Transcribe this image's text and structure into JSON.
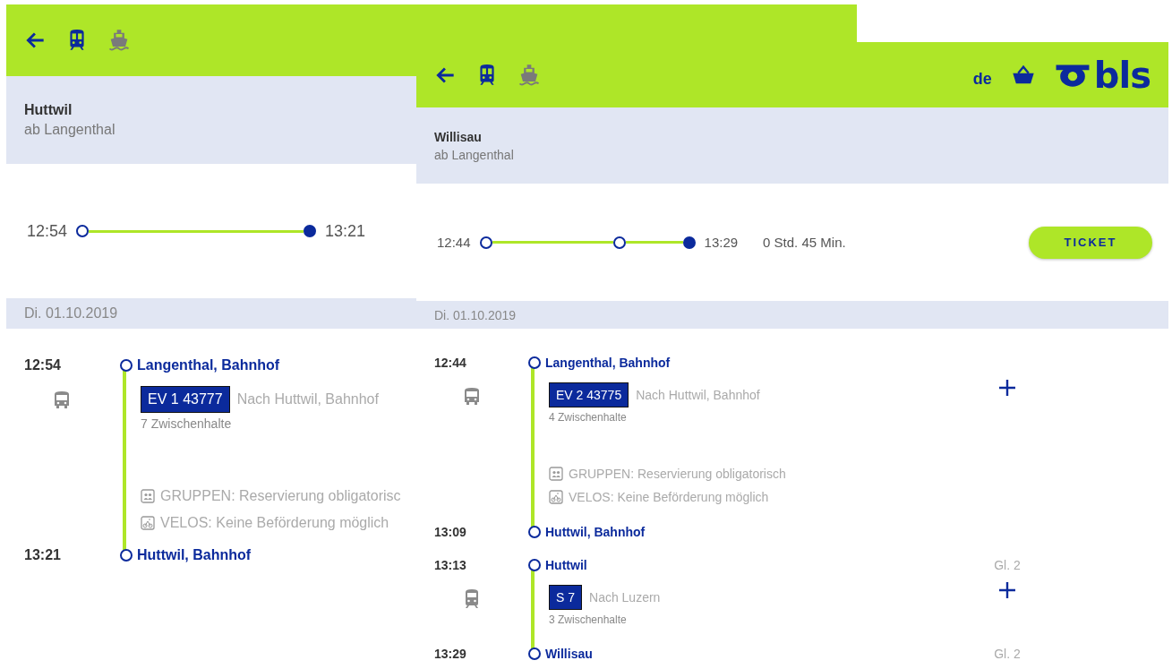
{
  "panels": [
    {
      "title": "Huttwil",
      "subtitle": "ab Langenthal",
      "timeline": {
        "start": "12:54",
        "end": "13:21",
        "dots": [
          {
            "filled": false
          },
          {
            "filled": true
          }
        ]
      },
      "date": "Di. 01.10.2019",
      "rows": [
        {
          "kind": "stop",
          "time": "12:54",
          "name": "Langenthal, Bahnhof"
        },
        {
          "kind": "bus",
          "badge": "EV 1 43777",
          "direction": "Nach Huttwil, Bahnhof",
          "stops": "7 Zwischenhalte",
          "notes": [
            {
              "kind": "groups",
              "text": "GRUPPEN: Reservierung obligatorisc"
            },
            {
              "kind": "bike",
              "text": "VELOS: Keine Beförderung möglich"
            }
          ]
        },
        {
          "kind": "stop",
          "time": "13:21",
          "name": "Huttwil, Bahnhof"
        }
      ]
    },
    {
      "header": {
        "language": "de",
        "logo_text": "bls"
      },
      "title": "Willisau",
      "subtitle": "ab Langenthal",
      "timeline": {
        "start": "12:44",
        "end": "13:29",
        "dots": [
          {
            "filled": false
          },
          {
            "filled": false
          },
          {
            "filled": true
          }
        ]
      },
      "duration": "0 Std. 45 Min.",
      "ticket": "TICKET",
      "date": "Di. 01.10.2019",
      "rows": [
        {
          "kind": "stop",
          "time": "12:44",
          "name": "Langenthal, Bahnhof"
        },
        {
          "kind": "bus",
          "badge": "EV 2 43775",
          "direction": "Nach Huttwil, Bahnhof",
          "stops": "4 Zwischenhalte",
          "plus": true,
          "notes": [
            {
              "kind": "groups",
              "text": "GRUPPEN: Reservierung obligatorisch"
            },
            {
              "kind": "bike",
              "text": "VELOS: Keine Beförderung möglich"
            }
          ]
        },
        {
          "kind": "stop",
          "time": "13:09",
          "name": "Huttwil, Bahnhof"
        },
        {
          "kind": "stop",
          "time": "13:13",
          "name": "Huttwil",
          "platform": "Gl. 2"
        },
        {
          "kind": "train",
          "badge": "S 7",
          "direction": "Nach Luzern",
          "stops": "3 Zwischenhalte",
          "plus": true
        },
        {
          "kind": "stop",
          "time": "13:29",
          "name": "Willisau",
          "platform": "Gl. 2"
        }
      ]
    }
  ]
}
